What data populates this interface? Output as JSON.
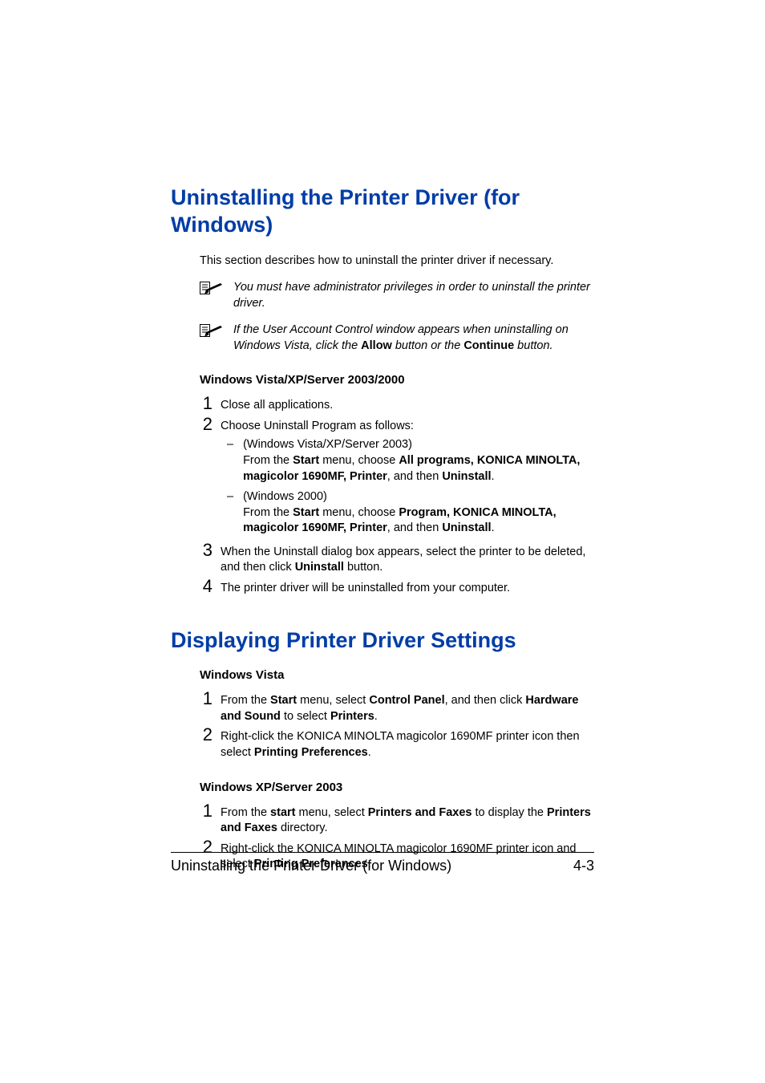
{
  "heading1": "Uninstalling the Printer Driver (for Windows)",
  "intro": "This section describes how to uninstall the printer driver if necessary.",
  "note1": {
    "text": "You must have administrator privileges in order to uninstall the printer driver."
  },
  "note2": {
    "pre": "If the User Account Control window appears when uninstalling on Windows Vista, click the ",
    "b1": "Allow",
    "mid": " button or the ",
    "b2": "Continue",
    "post": " button."
  },
  "sectionA": {
    "title": "Windows Vista/XP/Server 2003/2000",
    "step1": "Close all applications.",
    "step2": "Choose Uninstall Program as follows:",
    "sub1": {
      "line1": "(Windows Vista/XP/Server 2003)",
      "pre": "From the ",
      "b1": "Start",
      "mid1": " menu, choose ",
      "b2": "All programs, KONICA MINOLTA, magicolor 1690MF, Printer",
      "mid2": ", and then ",
      "b3": "Uninstall",
      "post": "."
    },
    "sub2": {
      "line1": "(Windows 2000)",
      "pre": "From the ",
      "b1": "Start",
      "mid1": " menu, choose ",
      "b2": "Program, KONICA MINOLTA, magicolor 1690MF, Printer",
      "mid2": ", and then ",
      "b3": "Uninstall",
      "post": "."
    },
    "step3": {
      "pre": "When the Uninstall dialog box appears, select the printer to be deleted, and then click ",
      "b1": "Uninstall",
      "post": " button."
    },
    "step4": "The printer driver will be uninstalled from your computer."
  },
  "heading2": "Displaying Printer Driver Settings",
  "sectionB": {
    "title": "Windows Vista",
    "step1": {
      "pre": "From the ",
      "b1": "Start",
      "mid1": " menu, select ",
      "b2": "Control Panel",
      "mid2": ", and then click ",
      "b3": "Hardware and Sound",
      "mid3": " to select ",
      "b4": "Printers",
      "post": "."
    },
    "step2": {
      "pre": "Right-click the KONICA MINOLTA magicolor 1690MF printer icon then select ",
      "b1": "Printing Preferences",
      "post": "."
    }
  },
  "sectionC": {
    "title": "Windows XP/Server 2003",
    "step1": {
      "pre": "From the ",
      "b1": "start",
      "mid1": " menu, select ",
      "b2": "Printers and Faxes",
      "mid2": " to display the ",
      "b3": "Printers and Faxes",
      "post": " directory."
    },
    "step2": {
      "pre": "Right-click the KONICA MINOLTA magicolor 1690MF printer icon and select ",
      "b1": "Printing Preferences",
      "post": "."
    }
  },
  "footer": {
    "left": "Uninstalling the Printer Driver (for Windows)",
    "right": "4-3"
  },
  "nums": {
    "n1": "1",
    "n2": "2",
    "n3": "3",
    "n4": "4"
  },
  "dash": "–"
}
